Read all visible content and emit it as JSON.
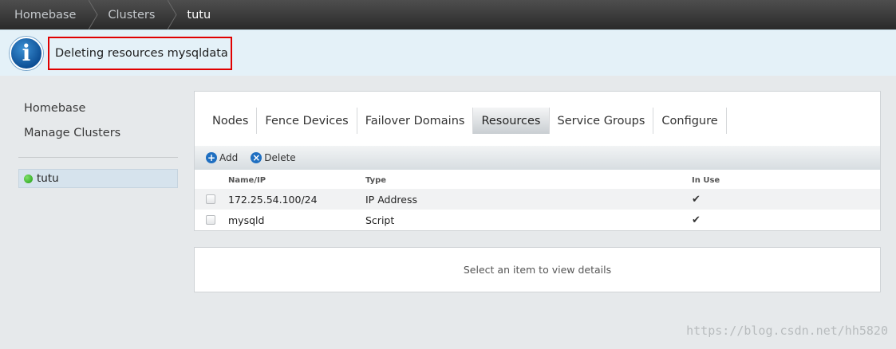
{
  "breadcrumb": [
    "Homebase",
    "Clusters",
    "tutu"
  ],
  "notification": {
    "message": "Deleting resources mysqldata",
    "icon": "info-icon"
  },
  "sidebar": {
    "links": [
      "Homebase",
      "Manage Clusters"
    ],
    "clusters": [
      {
        "name": "tutu",
        "status": "online"
      }
    ]
  },
  "tabs": [
    "Nodes",
    "Fence Devices",
    "Failover Domains",
    "Resources",
    "Service Groups",
    "Configure"
  ],
  "active_tab": "Resources",
  "toolbar": {
    "add_label": "Add",
    "delete_label": "Delete"
  },
  "table": {
    "columns": [
      "Name/IP",
      "Type",
      "In Use"
    ],
    "rows": [
      {
        "name": "172.25.54.100/24",
        "type": "IP Address",
        "in_use": "✔"
      },
      {
        "name": "mysqld",
        "type": "Script",
        "in_use": "✔"
      }
    ]
  },
  "details": {
    "placeholder": "Select an item to view details"
  },
  "watermark": "https://blog.csdn.net/hh5820"
}
